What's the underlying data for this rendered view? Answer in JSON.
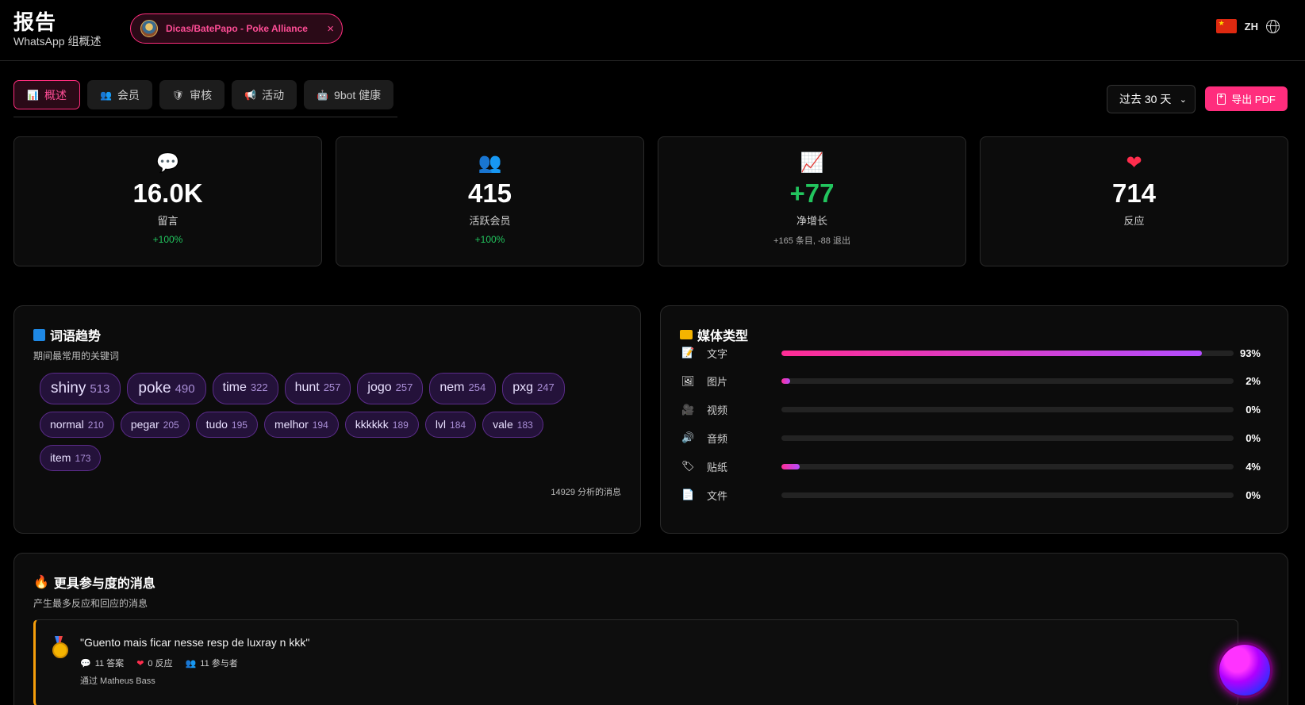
{
  "header": {
    "title": "报告",
    "subtitle": "WhatsApp 组概述",
    "group_chip": "Dicas/BatePapo - Poke Alliance",
    "close_glyph": "×",
    "lang_code": "ZH"
  },
  "tabs": [
    {
      "icon": "📊",
      "label": "概述",
      "active": true
    },
    {
      "icon": "👥",
      "label": "会员"
    },
    {
      "icon": "🛡",
      "label": "审核"
    },
    {
      "icon": "📢",
      "label": "活动"
    },
    {
      "icon": "🤖",
      "label": "9bot 健康"
    }
  ],
  "toolbar": {
    "period": "过去 30 天",
    "period_chevron": "⌄",
    "export_label": "导出 PDF"
  },
  "stats": [
    {
      "icon": "💬",
      "value": "16.0K",
      "label": "留言",
      "sub": "+100%"
    },
    {
      "icon": "👥",
      "value": "415",
      "label": "活跃会员",
      "sub": "+100%"
    },
    {
      "icon": "📈",
      "value": "+77",
      "label": "净增长",
      "sub": "+165 条目, -88 退出"
    },
    {
      "icon": "❤",
      "value": "714",
      "label": "反应",
      "sub": ""
    }
  ],
  "words_panel": {
    "title": "词语趋势",
    "desc": "期间最常用的关键词",
    "words": [
      {
        "w": "shiny",
        "c": "513"
      },
      {
        "w": "poke",
        "c": "490"
      },
      {
        "w": "time",
        "c": "322"
      },
      {
        "w": "hunt",
        "c": "257"
      },
      {
        "w": "jogo",
        "c": "257"
      },
      {
        "w": "nem",
        "c": "254"
      },
      {
        "w": "pxg",
        "c": "247"
      },
      {
        "w": "normal",
        "c": "210"
      },
      {
        "w": "pegar",
        "c": "205"
      },
      {
        "w": "tudo",
        "c": "195"
      },
      {
        "w": "melhor",
        "c": "194"
      },
      {
        "w": "kkkkkk",
        "c": "189"
      },
      {
        "w": "lvl",
        "c": "184"
      },
      {
        "w": "vale",
        "c": "183"
      },
      {
        "w": "item",
        "c": "173"
      }
    ],
    "analyzed": "14929 分析的消息"
  },
  "media_panel": {
    "title": "媒体类型",
    "rows": [
      {
        "icon": "📝",
        "label": "文字",
        "pct": "93%",
        "value": 0.93
      },
      {
        "icon": "🖼",
        "label": "图片",
        "pct": "2%",
        "value": 0.02
      },
      {
        "icon": "🎥",
        "label": "视频",
        "pct": "0%",
        "value": 0
      },
      {
        "icon": "🔊",
        "label": "音频",
        "pct": "0%",
        "value": 0
      },
      {
        "icon": "🏷",
        "label": "贴纸",
        "pct": "4%",
        "value": 0.04
      },
      {
        "icon": "📄",
        "label": "文件",
        "pct": "0%",
        "value": 0
      }
    ]
  },
  "engagement": {
    "title": "更具参与度的消息",
    "desc": "产生最多反应和回应的消息",
    "top": {
      "quote": "\"Guento mais ficar nesse resp de luxray n kkk\"",
      "replies": "11 答案",
      "reactions": "0 反应",
      "participants": "11 参与者",
      "author": "通过 Matheus Bass"
    }
  },
  "colors": {
    "accent": "#ff2d7d",
    "positive": "#22c55e",
    "word_chip": "#5b2c8a",
    "highlight_border": "#f59e0b"
  }
}
